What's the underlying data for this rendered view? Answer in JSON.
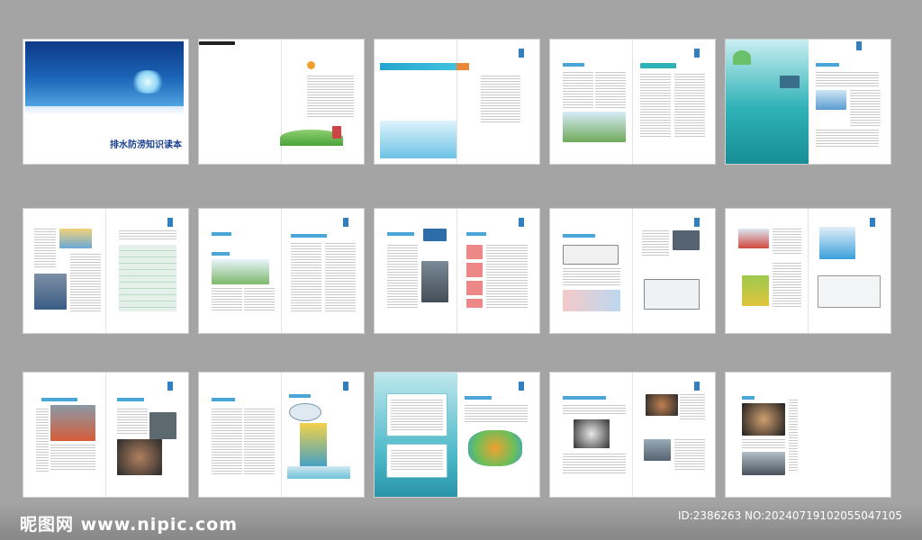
{
  "cover": {
    "title": "排水防涝知识读本"
  },
  "watermark": {
    "site": "昵图网 www.nipic.com",
    "id_text": "ID:2386263 NO:20240719102055047105"
  },
  "colors": {
    "background": "#a4a4a4",
    "accent_blue": "#2f7fc1",
    "accent_teal": "#2fb2b7",
    "accent_orange": "#e8873a"
  }
}
